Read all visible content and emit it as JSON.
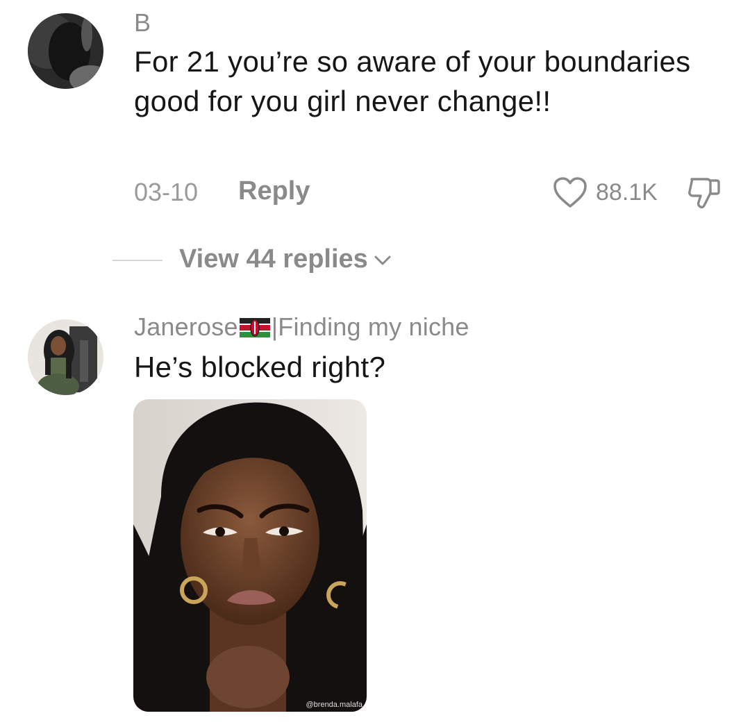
{
  "comments": [
    {
      "username": "B",
      "text": "For 21 you’re so aware of your boundaries good for you girl never change!!",
      "date": "03-10",
      "reply_label": "Reply",
      "like_count": "88.1K",
      "view_replies_label": "View 44 replies",
      "avatar_icon": "avatar-dark-photo"
    },
    {
      "username_name": "Janerose",
      "username_suffix": "|Finding my niche",
      "username_flag": "kenya-flag",
      "text": "He’s blocked right?",
      "avatar_icon": "avatar-woman-photo",
      "sticker": {
        "icon": "frowning-doll-sticker",
        "watermark": "@brenda.malafa"
      }
    }
  ],
  "colors": {
    "text_primary": "#161616",
    "text_secondary": "#8a8a8a",
    "background": "#ffffff"
  }
}
